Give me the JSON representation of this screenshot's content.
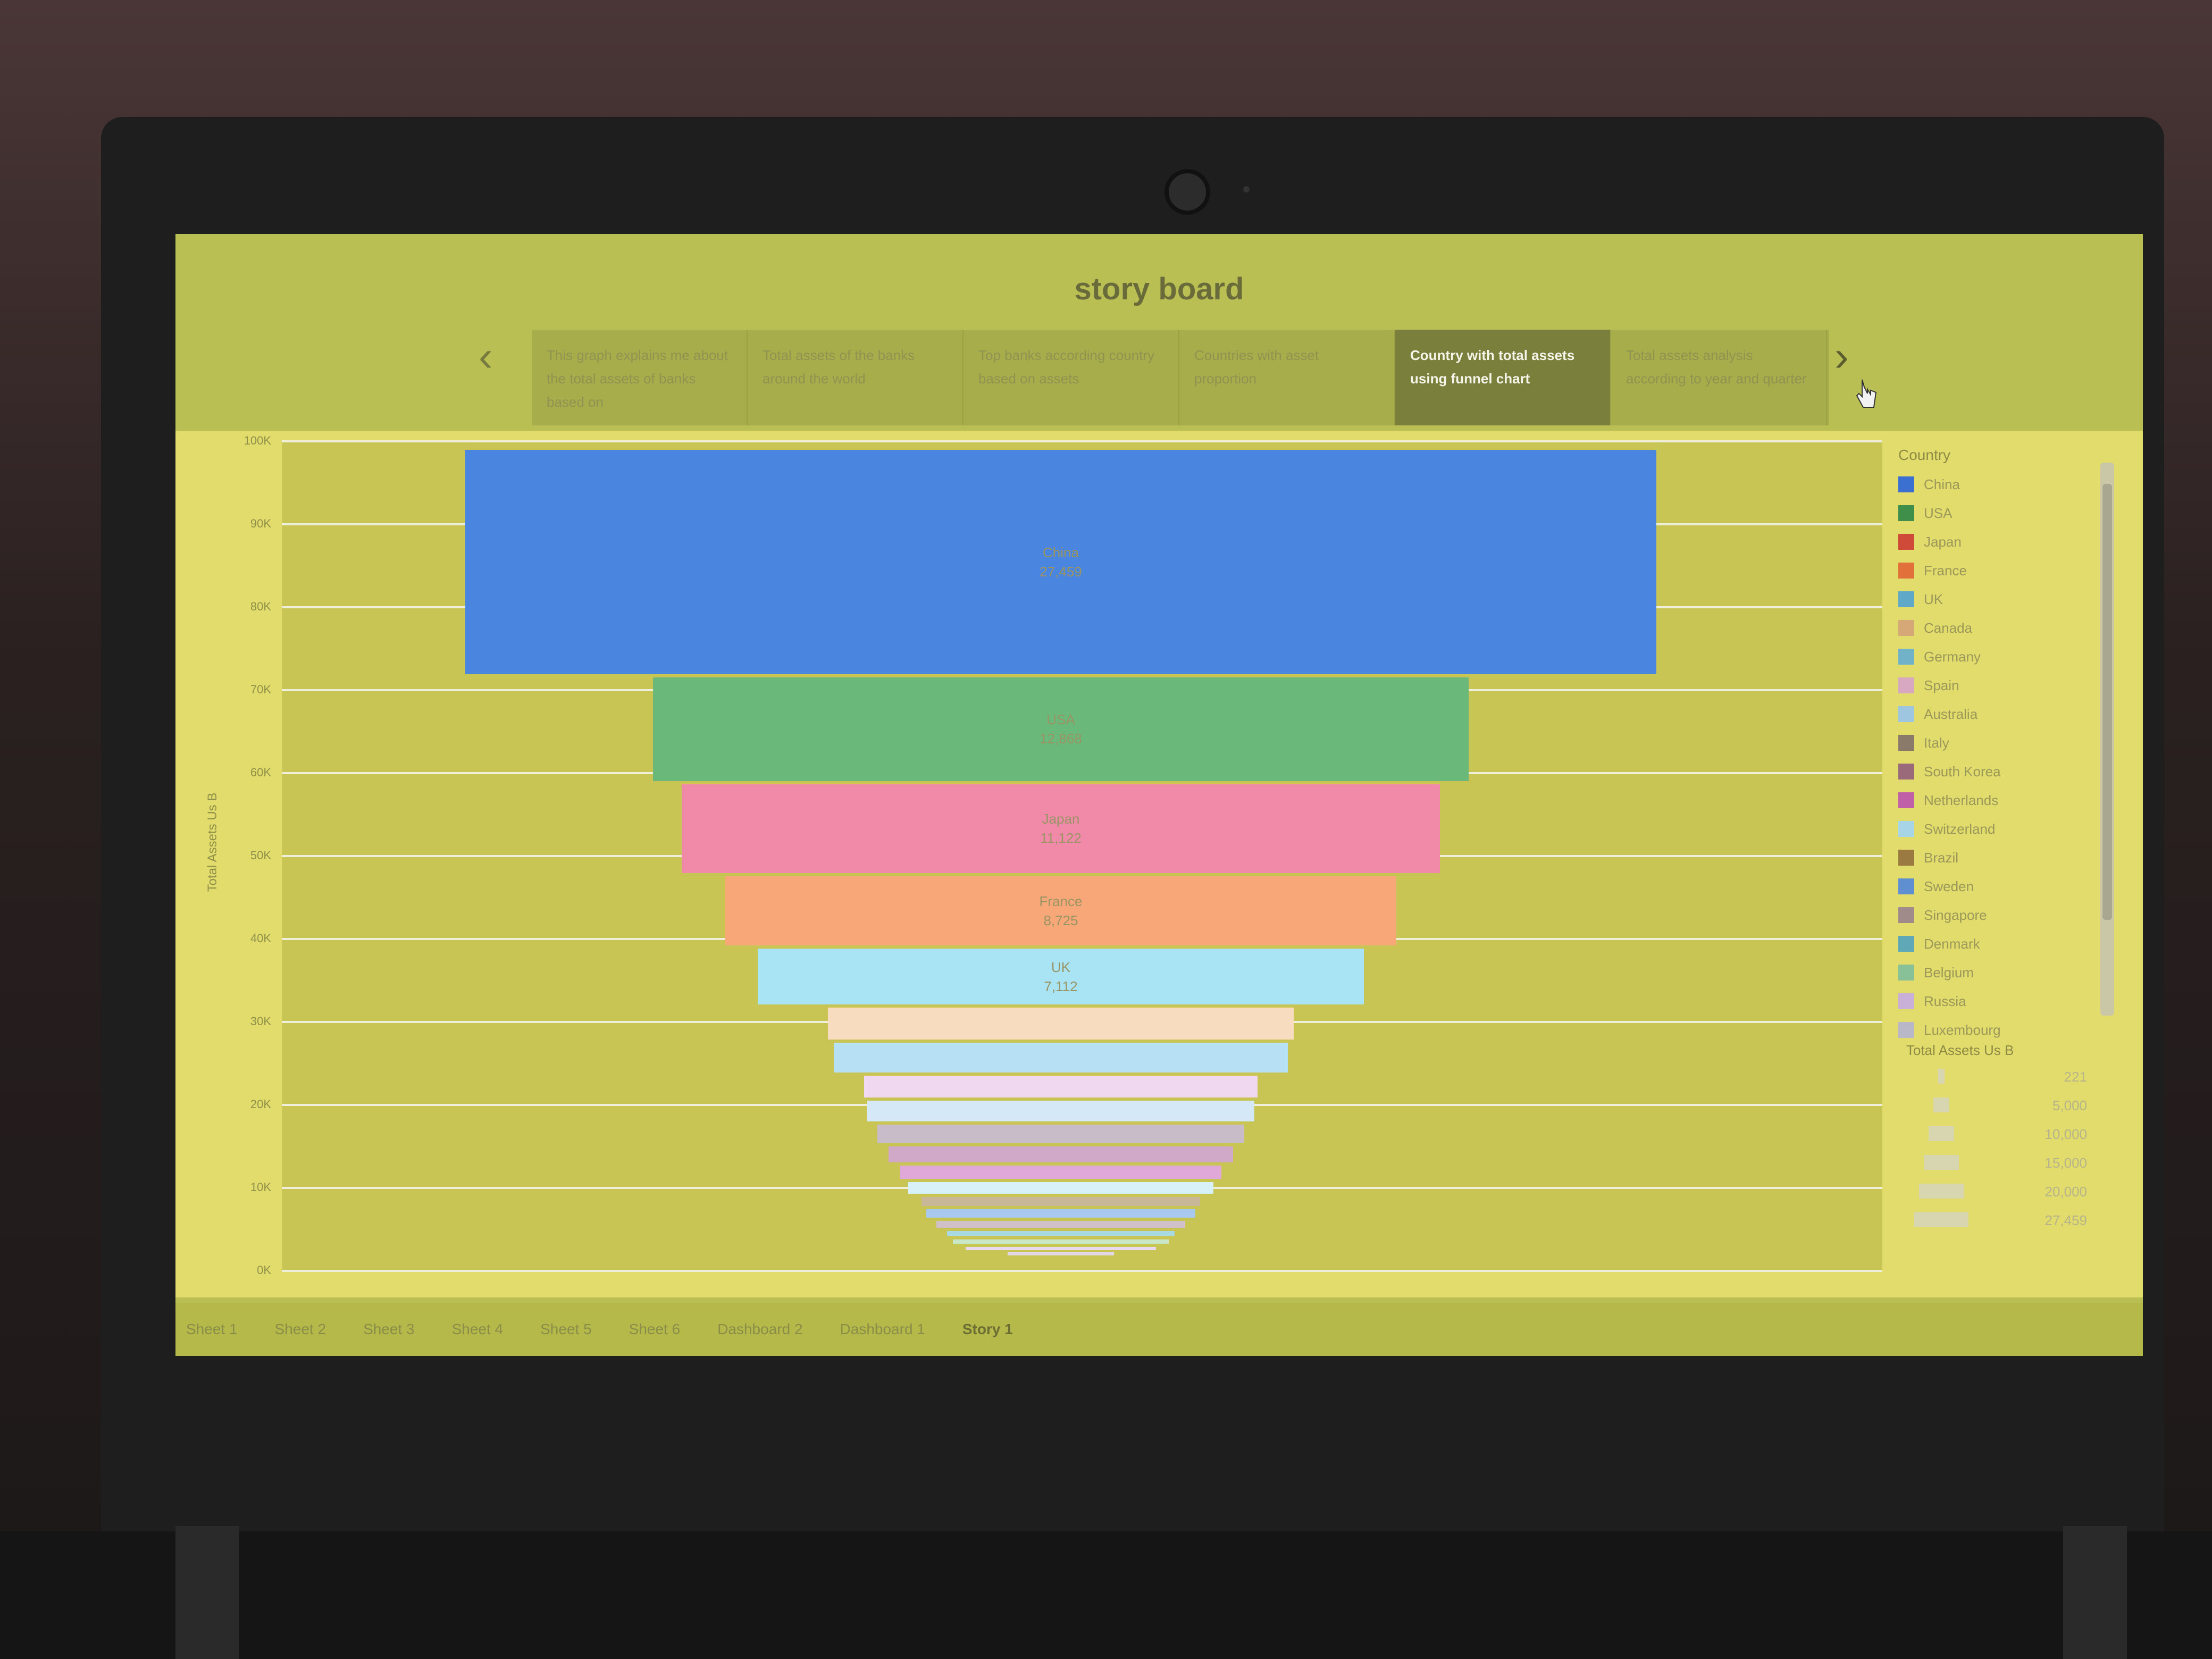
{
  "storyboard": {
    "title": "story board",
    "points": [
      {
        "text": "This graph explains me about the total assets of banks based on"
      },
      {
        "text": "Total assets of the banks around the world"
      },
      {
        "text": "Top banks according country based on assets"
      },
      {
        "text": "Countries with asset proportion"
      },
      {
        "text": "Country with total assets using funnel chart",
        "active": true
      },
      {
        "text": "Total assets analysis according to year and quarter"
      }
    ]
  },
  "chart": {
    "yaxis_title": "Total Assets Us B",
    "yticks": [
      "0K",
      "10K",
      "20K",
      "30K",
      "40K",
      "50K",
      "60K",
      "70K",
      "80K",
      "90K",
      "100K"
    ]
  },
  "chart_data": {
    "type": "bar",
    "orientation": "funnel",
    "ylabel": "Total Assets Us B",
    "ylim": [
      0,
      100000
    ],
    "categories": [
      "China",
      "USA",
      "Japan",
      "France",
      "UK",
      "Canada",
      "Germany",
      "Spain",
      "Australia",
      "Italy",
      "South Korea",
      "Netherlands",
      "Switzerland",
      "Brazil",
      "Sweden",
      "Singapore",
      "Denmark",
      "Belgium",
      "Russia",
      "Luxembourg"
    ],
    "values": [
      27459,
      12868,
      11122,
      8725,
      7112,
      4200,
      4000,
      3000,
      2900,
      2600,
      2300,
      2000,
      1800,
      1500,
      1400,
      1200,
      1000,
      900,
      700,
      221
    ],
    "labels": [
      {
        "country": "China",
        "value": "27,459"
      },
      {
        "country": "USA",
        "value": "12,868"
      },
      {
        "country": "Japan",
        "value": "11,122"
      },
      {
        "country": "France",
        "value": "8,725"
      },
      {
        "country": "UK",
        "value": "7,112"
      }
    ]
  },
  "legend": {
    "title": "Country",
    "items": [
      {
        "label": "China",
        "color": "#3b6fd0"
      },
      {
        "label": "USA",
        "color": "#3f8f4a"
      },
      {
        "label": "Japan",
        "color": "#d04a3a"
      },
      {
        "label": "France",
        "color": "#e2703a"
      },
      {
        "label": "UK",
        "color": "#5fa8c8"
      },
      {
        "label": "Canada",
        "color": "#d6a878"
      },
      {
        "label": "Germany",
        "color": "#72b2c8"
      },
      {
        "label": "Spain",
        "color": "#d8a8c0"
      },
      {
        "label": "Australia",
        "color": "#9fc6e0"
      },
      {
        "label": "Italy",
        "color": "#8a7a6a"
      },
      {
        "label": "South Korea",
        "color": "#9a6a7a"
      },
      {
        "label": "Netherlands",
        "color": "#c060a8"
      },
      {
        "label": "Switzerland",
        "color": "#a8d4e8"
      },
      {
        "label": "Brazil",
        "color": "#9a7a40"
      },
      {
        "label": "Sweden",
        "color": "#5f8fd0"
      },
      {
        "label": "Singapore",
        "color": "#a08a8a"
      },
      {
        "label": "Denmark",
        "color": "#60a8b8"
      },
      {
        "label": "Belgium",
        "color": "#88c098"
      },
      {
        "label": "Russia",
        "color": "#c8b0d8"
      },
      {
        "label": "Luxembourg",
        "color": "#b8b8c8"
      }
    ],
    "size_title": "Total Assets Us B",
    "size_values": [
      "221",
      "5,000",
      "10,000",
      "15,000",
      "20,000",
      "27,459"
    ]
  },
  "sheet_tabs": [
    {
      "label": "Sheet 1"
    },
    {
      "label": "Sheet 2"
    },
    {
      "label": "Sheet 3"
    },
    {
      "label": "Sheet 4"
    },
    {
      "label": "Sheet 5"
    },
    {
      "label": "Sheet 6"
    },
    {
      "label": "Dashboard 2"
    },
    {
      "label": "Dashboard 1"
    },
    {
      "label": "Story 1",
      "active": true
    }
  ],
  "colors": {
    "screen_bg": "#b9bf52",
    "plot_bg": "#c8c554",
    "active_story_point": "#7b7f3c"
  }
}
